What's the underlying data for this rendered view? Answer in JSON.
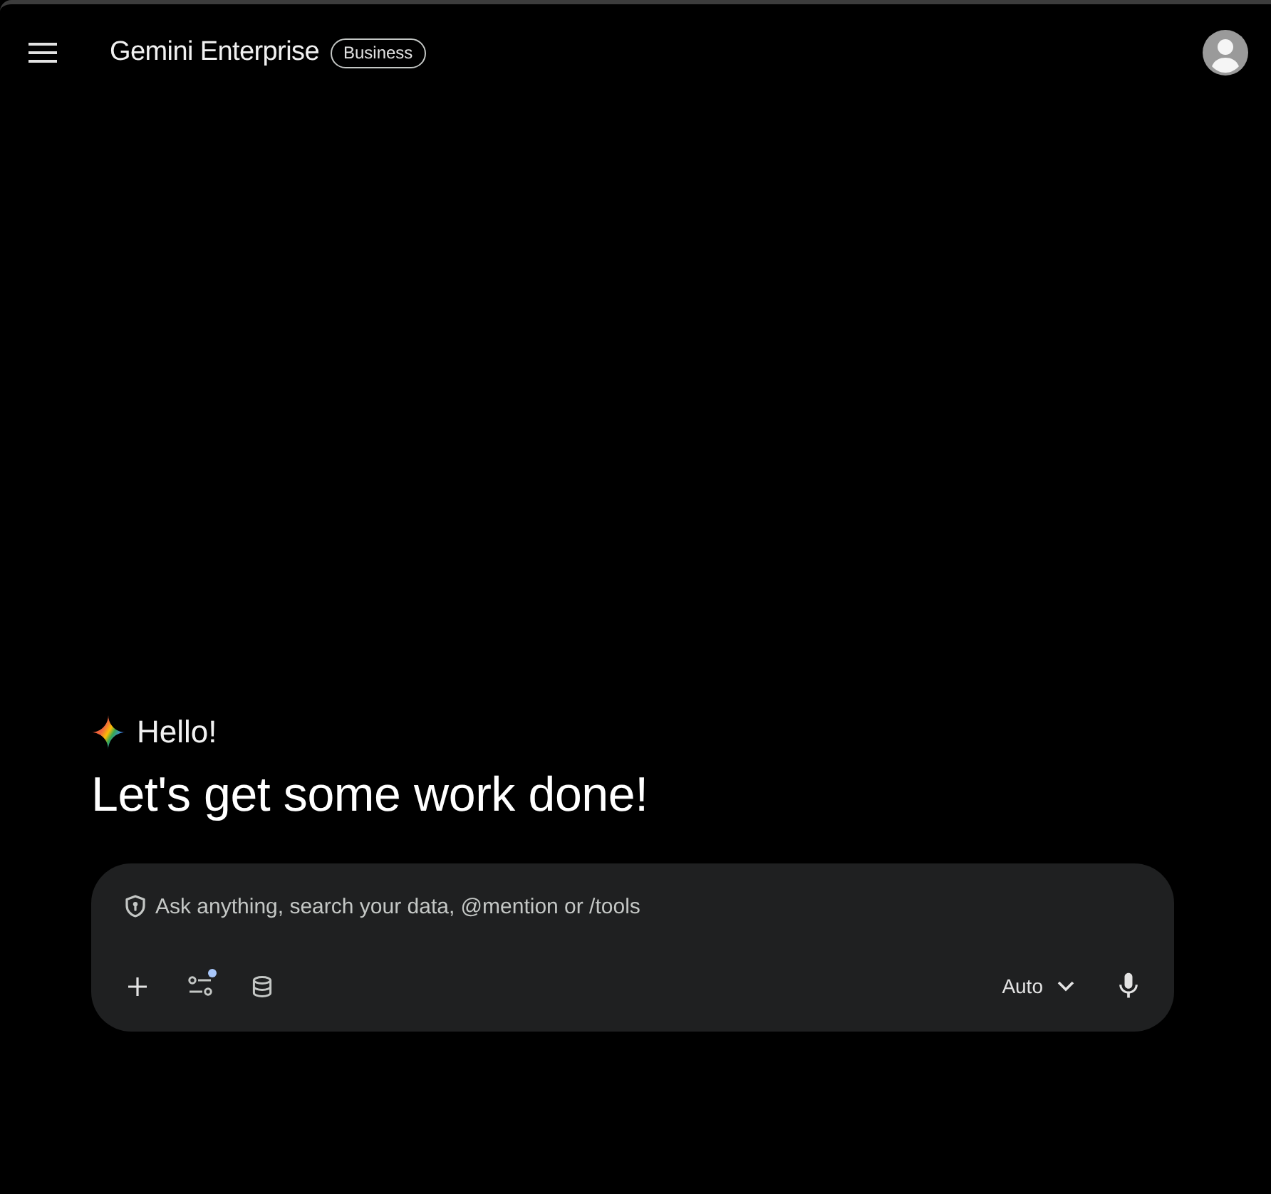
{
  "header": {
    "title": "Gemini Enterprise",
    "badge": "Business"
  },
  "greeting": {
    "hello": "Hello!",
    "headline": "Let's get some work done!"
  },
  "prompt": {
    "placeholder": "Ask anything, search your data, @mention or /tools",
    "left_actions": [
      {
        "kind": "add",
        "indicator": false
      },
      {
        "kind": "tools",
        "indicator": true
      },
      {
        "kind": "data",
        "indicator": false
      }
    ],
    "model_selector": {
      "label": "Auto"
    }
  }
}
